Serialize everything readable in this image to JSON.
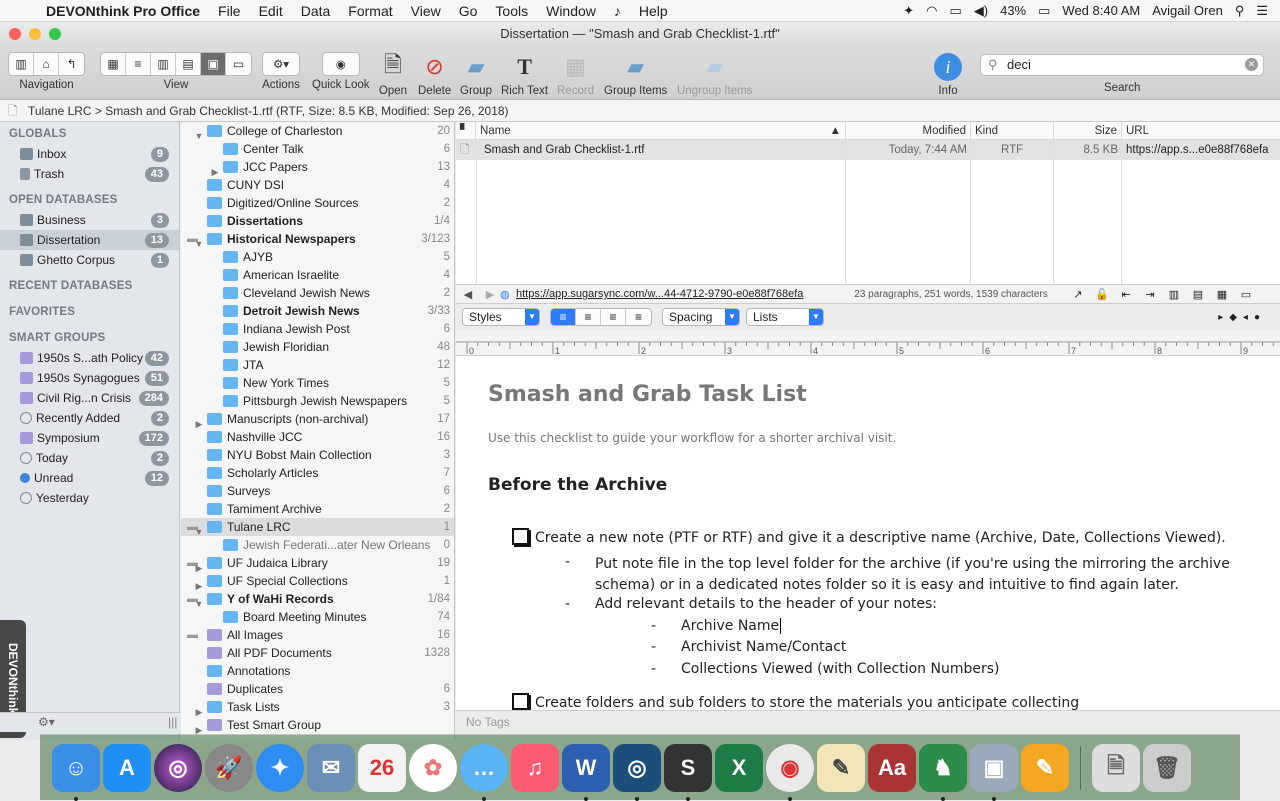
{
  "menubar": {
    "app_name": "DEVONthink Pro Office",
    "items": [
      "File",
      "Edit",
      "Data",
      "Format",
      "View",
      "Go",
      "Tools",
      "Window",
      "Help"
    ],
    "battery": "43%",
    "clock": "Wed 8:40 AM",
    "user": "Avigail Oren"
  },
  "window": {
    "title": "Dissertation — \"Smash and Grab Checklist-1.rtf\""
  },
  "toolbar": {
    "navigation_label": "Navigation",
    "view_label": "View",
    "actions_label": "Actions",
    "quicklook_label": "Quick Look",
    "open_label": "Open",
    "delete_label": "Delete",
    "group_label": "Group",
    "richtext_label": "Rich Text",
    "record_label": "Record",
    "groupitems_label": "Group Items",
    "ungroup_label": "Ungroup Items",
    "info_label": "Info",
    "search_label": "Search",
    "search_value": "deci"
  },
  "pathbar": {
    "text": "Tulane LRC > Smash and Grab Checklist-1.rtf (RTF, Size: 8.5 KB, Modified: Sep 26, 2018)"
  },
  "sidebar": {
    "globals_head": "GLOBALS",
    "inbox": {
      "label": "Inbox",
      "count": "9"
    },
    "trash": {
      "label": "Trash",
      "count": "43"
    },
    "open_db_head": "OPEN DATABASES",
    "business": {
      "label": "Business",
      "count": "3"
    },
    "dissertation": {
      "label": "Dissertation",
      "count": "13"
    },
    "ghetto": {
      "label": "Ghetto Corpus",
      "count": "1"
    },
    "recent_head": "RECENT DATABASES",
    "favorites_head": "FAVORITES",
    "smart_head": "SMART GROUPS",
    "smart": [
      {
        "label": "1950s S...ath Policy",
        "count": "42"
      },
      {
        "label": "1950s Synagogues",
        "count": "51"
      },
      {
        "label": "Civil Rig...n Crisis",
        "count": "284"
      },
      {
        "label": "Recently Added",
        "count": "2"
      },
      {
        "label": "Symposium",
        "count": "172"
      },
      {
        "label": "Today",
        "count": "2"
      },
      {
        "label": "Unread",
        "count": "12"
      },
      {
        "label": "Yesterday",
        "count": ""
      }
    ],
    "devon_tab": "DEVONthink"
  },
  "tree": [
    {
      "label": "College of Charleston",
      "count": "20",
      "level": 0,
      "tri": "down"
    },
    {
      "label": "Center Talk",
      "count": "6",
      "level": 1,
      "tri": ""
    },
    {
      "label": "JCC Papers",
      "count": "13",
      "level": 1,
      "tri": "right"
    },
    {
      "label": "CUNY DSI",
      "count": "4",
      "level": 0,
      "tri": ""
    },
    {
      "label": "Digitized/Online Sources",
      "count": "2",
      "level": 0,
      "tri": ""
    },
    {
      "label": "Dissertations",
      "count": "1/4",
      "level": 0,
      "tri": "",
      "bold": true
    },
    {
      "label": "Historical Newspapers",
      "count": "3/123",
      "level": 0,
      "tri": "down",
      "bold": true
    },
    {
      "label": "AJYB",
      "count": "5",
      "level": 1,
      "tri": ""
    },
    {
      "label": "American Israelite",
      "count": "4",
      "level": 1,
      "tri": ""
    },
    {
      "label": "Cleveland Jewish News",
      "count": "2",
      "level": 1,
      "tri": ""
    },
    {
      "label": "Detroit Jewish News",
      "count": "3/33",
      "level": 1,
      "tri": "",
      "bold": true
    },
    {
      "label": "Indiana Jewish Post",
      "count": "6",
      "level": 1,
      "tri": ""
    },
    {
      "label": "Jewish Floridian",
      "count": "48",
      "level": 1,
      "tri": ""
    },
    {
      "label": "JTA",
      "count": "12",
      "level": 1,
      "tri": ""
    },
    {
      "label": "New York Times",
      "count": "5",
      "level": 1,
      "tri": ""
    },
    {
      "label": "Pittsburgh Jewish Newspapers",
      "count": "5",
      "level": 1,
      "tri": ""
    },
    {
      "label": "Manuscripts (non-archival)",
      "count": "17",
      "level": 0,
      "tri": "right"
    },
    {
      "label": "Nashville JCC",
      "count": "16",
      "level": 0,
      "tri": ""
    },
    {
      "label": "NYU Bobst Main Collection",
      "count": "3",
      "level": 0,
      "tri": ""
    },
    {
      "label": "Scholarly Articles",
      "count": "7",
      "level": 0,
      "tri": ""
    },
    {
      "label": "Surveys",
      "count": "6",
      "level": 0,
      "tri": ""
    },
    {
      "label": "Tamiment Archive",
      "count": "2",
      "level": 0,
      "tri": ""
    },
    {
      "label": "Tulane LRC",
      "count": "1",
      "level": 0,
      "tri": "down",
      "sel": true
    },
    {
      "label": "Jewish Federati...ater New Orleans",
      "count": "0",
      "level": 1,
      "tri": "",
      "gray": true
    },
    {
      "label": "UF Judaica Library",
      "count": "19",
      "level": 0,
      "tri": "right"
    },
    {
      "label": "UF Special Collections",
      "count": "1",
      "level": 0,
      "tri": "right"
    },
    {
      "label": "Y of WaHi Records",
      "count": "1/84",
      "level": 0,
      "tri": "down",
      "bold": true
    },
    {
      "label": "Board Meeting Minutes",
      "count": "74",
      "level": 1,
      "tri": ""
    },
    {
      "label": "All Images",
      "count": "16",
      "level": 0,
      "tri": "",
      "smart": true
    },
    {
      "label": "All PDF Documents",
      "count": "1328",
      "level": 0,
      "tri": "",
      "smart": true
    },
    {
      "label": "Annotations",
      "count": "",
      "level": 0,
      "tri": ""
    },
    {
      "label": "Duplicates",
      "count": "6",
      "level": 0,
      "tri": "",
      "smart": true
    },
    {
      "label": "Task Lists",
      "count": "3",
      "level": 0,
      "tri": "right"
    },
    {
      "label": "Test Smart Group",
      "count": "",
      "level": 0,
      "tri": "right",
      "smart": true
    }
  ],
  "list": {
    "headers": {
      "name": "Name",
      "modified": "Modified",
      "kind": "Kind",
      "size": "Size",
      "url": "URL"
    },
    "row": {
      "name": "Smash and Grab Checklist-1.rtf",
      "modified": "Today, 7:44 AM",
      "kind": "RTF",
      "size": "8.5 KB",
      "url": "https://app.s...e0e88f768efa"
    }
  },
  "urlbar": {
    "url": "https://app.sugarsync.com/w...44-4712-9790-e0e88f768efa",
    "stats": "23 paragraphs, 251 words, 1539 characters"
  },
  "format": {
    "styles": "Styles",
    "spacing": "Spacing",
    "lists": "Lists"
  },
  "ruler": [
    "0",
    "1",
    "2",
    "3",
    "4",
    "5",
    "6",
    "7",
    "8",
    "9"
  ],
  "doc": {
    "title": "Smash and Grab Task List",
    "subtitle": "Use this checklist to guide your workflow for a shorter archival visit.",
    "h2": "Before the Archive",
    "item1": "Create a new note (PTF or RTF) and give it a descriptive name (Archive, Date, Collections Viewed).",
    "sub1": "Put note file in the top level folder for the archive (if you're using the mirroring the archive schema) or in a dedicated notes folder so it is easy and intuitive to find again later.",
    "sub2": "Add relevant details to the header of your notes:",
    "sub2a": "Archive Name",
    "sub2b": "Archivist Name/Contact",
    "sub2c": "Collections Viewed (with Collection Numbers)",
    "item2": "Create folders and sub folders to store the materials you anticipate collecting"
  },
  "tags_placeholder": "No Tags",
  "colors": {
    "accent": "#2f7df6",
    "folder": "#65b6f0",
    "badge": "#8e96a0"
  }
}
